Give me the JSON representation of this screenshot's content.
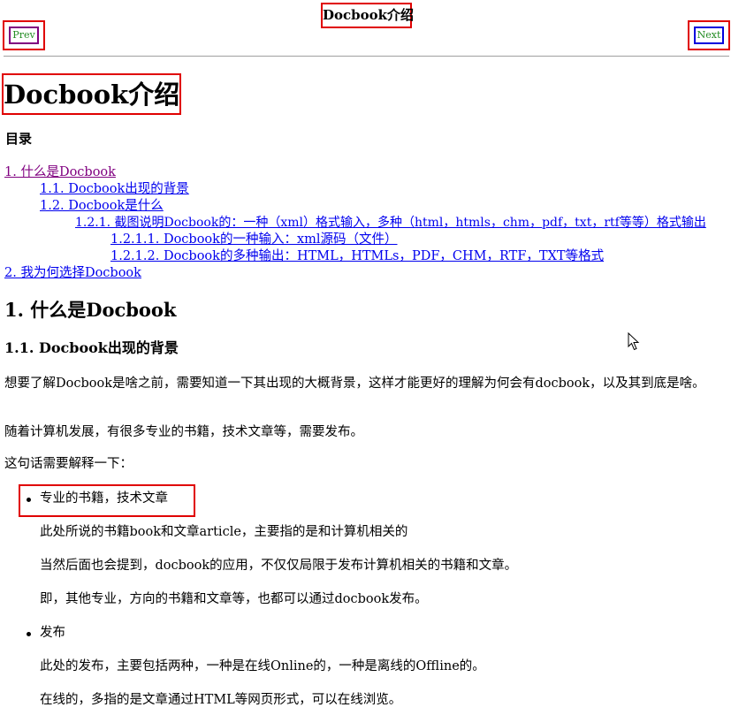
{
  "nav": {
    "title": "Docbook介绍",
    "prev_label": "Prev",
    "next_label": "Next"
  },
  "main_title": "Docbook介绍",
  "toc": {
    "heading": "目录",
    "items": [
      {
        "label": "1. 什么是Docbook",
        "level": 0
      },
      {
        "label": "1.1. Docbook出现的背景",
        "level": 1
      },
      {
        "label": "1.2. Docbook是什么",
        "level": 1
      },
      {
        "label": "1.2.1. 截图说明Docbook的：一种（xml）格式输入，多种（html，htmls，chm，pdf，txt，rtf等等）格式输出",
        "level": 2
      },
      {
        "label": "1.2.1.1. Docbook的一种输入：xml源码（文件）",
        "level": 3
      },
      {
        "label": "1.2.1.2. Docbook的多种输出：HTML，HTMLs，PDF，CHM，RTF，TXT等格式",
        "level": 3
      },
      {
        "label": "2. 我为何选择Docbook",
        "level": 0
      }
    ]
  },
  "content": {
    "section_title": "1. 什么是Docbook",
    "subsection_title": "1.1. Docbook出现的背景",
    "para1": "想要了解Docbook是啥之前，需要知道一下其出现的大概背景，这样才能更好的理解为何会有docbook，以及其到底是啥。",
    "para2": "随着计算机发展，有很多专业的书籍，技术文章等，需要发布。",
    "para3": "这句话需要解释一下：",
    "list": [
      {
        "label": "专业的书籍，技术文章",
        "paras": [
          "此处所说的书籍book和文章article，主要指的是和计算机相关的",
          "当然后面也会提到，docbook的应用，不仅仅局限于发布计算机相关的书籍和文章。",
          "即，其他专业，方向的书籍和文章等，也都可以通过docbook发布。"
        ]
      },
      {
        "label": "发布",
        "paras": [
          "此处的发布，主要包括两种，一种是在线Online的，一种是离线的Offline的。",
          "在线的，多指的是文章通过HTML等网页形式，可以在线浏览。"
        ]
      }
    ]
  },
  "colors": {
    "annotation": "#e00000",
    "link": "#0000ee",
    "visited_link": "#800080",
    "nav_text": "#228b22"
  },
  "icons": {
    "cursor": "mouse-pointer-icon",
    "bullet": "bullet-dot-icon"
  }
}
